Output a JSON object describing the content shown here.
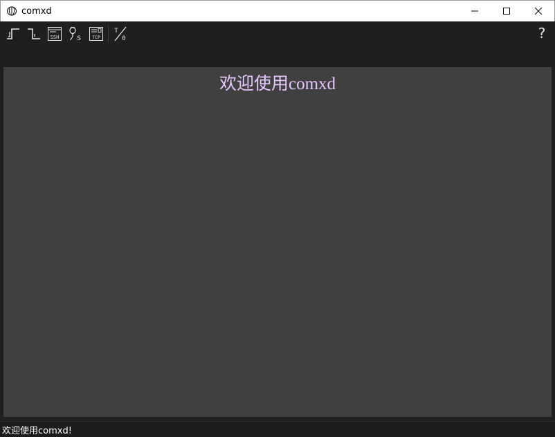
{
  "window": {
    "title": "comxd",
    "controls": [
      "minimize",
      "maximize",
      "close"
    ]
  },
  "toolbar": {
    "buttons": [
      {
        "name": "serial-connect",
        "icon": "rising-edge-icon"
      },
      {
        "name": "serial-disconnect",
        "icon": "falling-edge-icon"
      },
      {
        "name": "ssh",
        "icon": "ssh-terminal-icon",
        "label": "SSH"
      },
      {
        "name": "telnet",
        "icon": "plug-s-icon",
        "label": "S"
      },
      {
        "name": "tcp",
        "icon": "tcp-terminal-icon",
        "label": "TCP"
      },
      {
        "name": "io",
        "icon": "io-toggle-icon",
        "label_top": "T",
        "label_bottom": "0"
      }
    ],
    "help_label": "?"
  },
  "main": {
    "welcome_text": "欢迎使用comxd",
    "welcome_color": "#e6c8ff",
    "background": "#404040"
  },
  "statusbar": {
    "text": "欢迎使用comxd!"
  }
}
